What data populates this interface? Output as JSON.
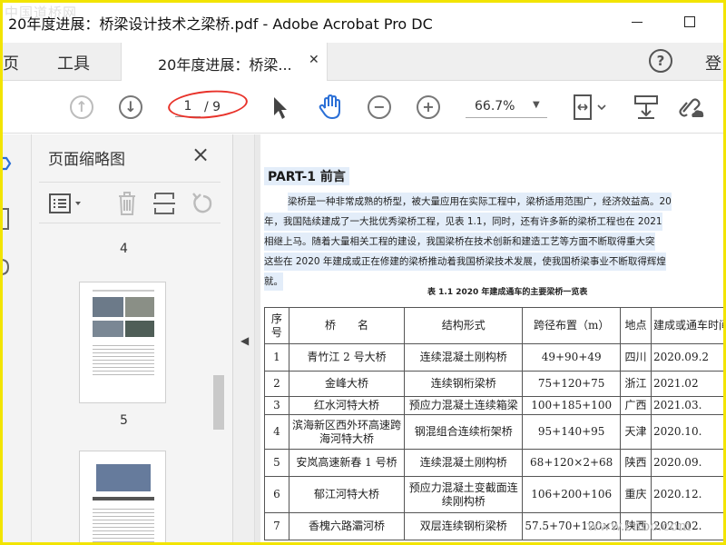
{
  "window": {
    "title": "20年度进展：桥梁设计技术之梁桥.pdf - Adobe Acrobat Pro DC",
    "watermark_top": "中国道桥网"
  },
  "tabs": {
    "home": "主页",
    "tools": "工具",
    "doc_tab_label": "20年度进展：桥梁...",
    "close": "✕",
    "signin": "登"
  },
  "toolbar": {
    "current_page": "1",
    "page_total": "/ 9",
    "zoom": "66.7%"
  },
  "panel": {
    "title": "页面缩略图",
    "thumb_labels": [
      "4",
      "5"
    ]
  },
  "document": {
    "heading": "PART-1  前言",
    "paragraph_lines": [
      "梁桥是一种非常成熟的桥型，被大量应用在实际工程中，梁桥适用范围广，经济效益高。20",
      "年，我国陆续建成了一大批优秀梁桥工程，见表 1.1，同时，还有许多新的梁桥工程也在 2021",
      "相继上马。随着大量相关工程的建设，我国梁桥在技术创新和建造工艺等方面不断取得重大突",
      "这些在 2020 年建成或正在修建的梁桥推动着我国桥梁技术发展，使我国桥梁事业不断取得辉煌",
      "就。"
    ],
    "table_caption": "表 1.1   2020 年建成通车的主要梁桥一览表",
    "table": {
      "headers": [
        "序号",
        "桥　　名",
        "结构形式",
        "跨径布置（m）",
        "地点",
        "建成或通车时间"
      ],
      "rows": [
        [
          "1",
          "青竹江 2 号大桥",
          "连续混凝土刚构桥",
          "49+90+49",
          "四川",
          "2020.09.2"
        ],
        [
          "2",
          "金峰大桥",
          "连续钢桁梁桥",
          "75+120+75",
          "浙江",
          "2021.02"
        ],
        [
          "3",
          "红水河特大桥",
          "预应力混凝土连续箱梁",
          "100+185+100",
          "广西",
          "2021.03."
        ],
        [
          "4",
          "滨海新区西外环高速跨海河特大桥",
          "钢混组合连续桁架桥",
          "95+140+95",
          "天津",
          "2020.10."
        ],
        [
          "5",
          "安岚高速新春 1 号桥",
          "连续混凝土刚构桥",
          "68+120×2+68",
          "陕西",
          "2020.09."
        ],
        [
          "6",
          "郁江河特大桥",
          "预应力混凝土变截面连续刚构桥",
          "106+200+106",
          "重庆",
          "2020.12."
        ],
        [
          "7",
          "香槐六路灞河桥",
          "双层连续钢桁梁桥",
          "57.5+70+120×2",
          "陕西",
          "2021.02."
        ]
      ]
    }
  },
  "watermark_bottom": "www.cnbo.com"
}
